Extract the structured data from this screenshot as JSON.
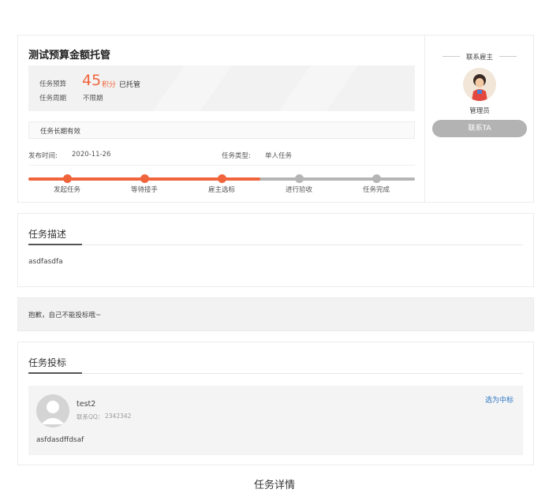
{
  "task": {
    "title": "测试预算金额托管",
    "budget_label": "任务预算",
    "budget_amount": "45",
    "budget_unit": "积分",
    "budget_status": "已托管",
    "period_label": "任务周期",
    "period_value": "不限期",
    "validity": "任务长期有效",
    "publish_label": "发布时间:",
    "publish_date": "2020-11-26",
    "type_label": "任务类型:",
    "type_value": "单人任务",
    "progress": {
      "completed_steps": 3,
      "steps": [
        "发起任务",
        "等待接手",
        "雇主选标",
        "进行验收",
        "任务完成"
      ]
    }
  },
  "employer": {
    "contact_title": "联系雇主",
    "name": "管理员",
    "contact_button": "联系TA"
  },
  "description": {
    "title": "任务描述",
    "content": "asdfasdfa"
  },
  "notice": "抱歉，自己不能投标哦~",
  "bids": {
    "title": "任务投标",
    "items": [
      {
        "name": "test2",
        "qq_label": "联系QQ：",
        "qq": "2342342",
        "select_label": "选为中标",
        "content": "asfdasdffdsaf"
      }
    ]
  },
  "page_caption": "任务详情",
  "colors": {
    "accent": "#f0643c",
    "inactive": "#b5b5b5",
    "link": "#2f78c4"
  }
}
